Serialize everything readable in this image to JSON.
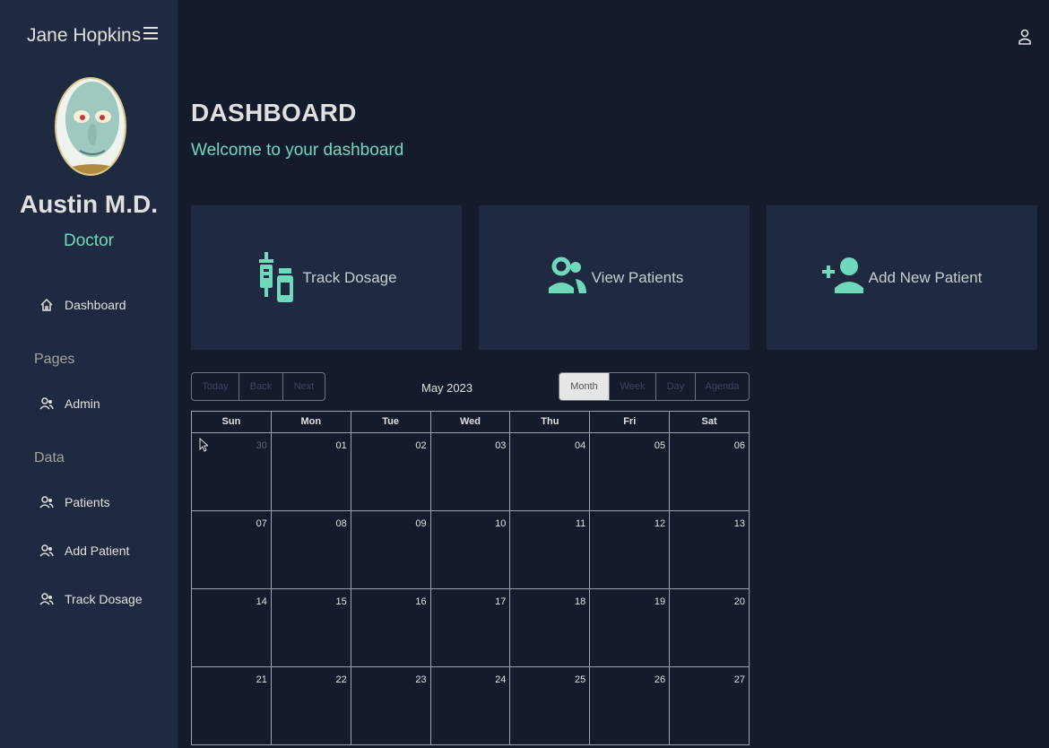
{
  "sidebar": {
    "app_title": "Jane Hopkins",
    "user_name": "Austin M.D.",
    "user_role": "Doctor",
    "dashboard_label": "Dashboard",
    "pages_section": "Pages",
    "admin_label": "Admin",
    "data_section": "Data",
    "patients_label": "Patients",
    "add_patient_label": "Add Patient",
    "track_dosage_label": "Track Dosage"
  },
  "header": {
    "title": "DASHBOARD",
    "subtitle": "Welcome to your dashboard"
  },
  "cards": [
    {
      "label": "Track Dosage",
      "icon": "vaccines-icon"
    },
    {
      "label": "View Patients",
      "icon": "people-icon"
    },
    {
      "label": "Add New Patient",
      "icon": "person-add-icon"
    }
  ],
  "calendar": {
    "title": "May 2023",
    "view_buttons": [
      "Month",
      "Week",
      "Day",
      "Agenda"
    ],
    "active_view": "Month",
    "nav_buttons": [
      "Today",
      "Back",
      "Next"
    ],
    "weekdays": [
      "Sun",
      "Mon",
      "Tue",
      "Wed",
      "Thu",
      "Fri",
      "Sat"
    ],
    "weeks": [
      [
        "30",
        "01",
        "02",
        "03",
        "04",
        "05",
        "06"
      ],
      [
        "07",
        "08",
        "09",
        "10",
        "11",
        "12",
        "13"
      ],
      [
        "14",
        "15",
        "16",
        "17",
        "18",
        "19",
        "20"
      ],
      [
        "21",
        "22",
        "23",
        "24",
        "25",
        "26",
        "27"
      ]
    ]
  },
  "colors": {
    "background": "#141b2d",
    "panel": "#1f2a40",
    "accent": "#70d8bd"
  }
}
